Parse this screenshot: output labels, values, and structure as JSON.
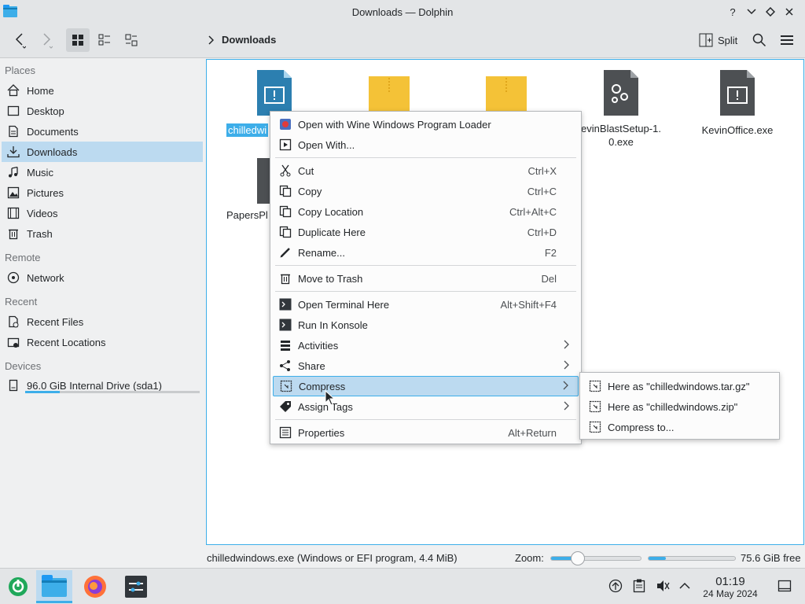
{
  "window": {
    "title": "Downloads — Dolphin"
  },
  "window_controls": {
    "help": "?",
    "minimize": "⌄",
    "maximize": "◇",
    "close": "✕"
  },
  "toolbar": {
    "breadcrumb_label": "Downloads",
    "split_label": "Split"
  },
  "sidebar": {
    "places_title": "Places",
    "places": [
      {
        "label": "Home",
        "icon": "home-icon"
      },
      {
        "label": "Desktop",
        "icon": "desktop-icon"
      },
      {
        "label": "Documents",
        "icon": "documents-icon"
      },
      {
        "label": "Downloads",
        "icon": "downloads-icon"
      },
      {
        "label": "Music",
        "icon": "music-icon"
      },
      {
        "label": "Pictures",
        "icon": "pictures-icon"
      },
      {
        "label": "Videos",
        "icon": "videos-icon"
      },
      {
        "label": "Trash",
        "icon": "trash-icon"
      }
    ],
    "remote_title": "Remote",
    "remote": [
      {
        "label": "Network",
        "icon": "network-icon"
      }
    ],
    "recent_title": "Recent",
    "recent": [
      {
        "label": "Recent Files",
        "icon": "recent-files-icon"
      },
      {
        "label": "Recent Locations",
        "icon": "recent-locations-icon"
      }
    ],
    "devices_title": "Devices",
    "devices": [
      {
        "label": "96.0 GiB Internal Drive (sda1)",
        "icon": "drive-icon",
        "usage_fraction": 0.2
      }
    ]
  },
  "files": [
    {
      "name": "chilledwi",
      "type": "exe",
      "selected": true
    },
    {
      "name": "",
      "type": "zip"
    },
    {
      "name": "",
      "type": "zip"
    },
    {
      "name": "KevinBlastSetup-1.0.exe",
      "line1": "evinBlastSetup-1.",
      "line2": "0.exe",
      "type": "setup"
    },
    {
      "name": "KevinOffice.exe",
      "type": "exe-dark"
    },
    {
      "name": "PapersPl",
      "type": "exe-dark"
    }
  ],
  "context_menu": {
    "items": [
      {
        "label": "Open with Wine Windows Program Loader",
        "icon": "wine-icon",
        "shortcut": ""
      },
      {
        "label": "Open With...",
        "icon": "open-with-icon",
        "shortcut": ""
      },
      {
        "label": "Cut",
        "icon": "cut-icon",
        "shortcut": "Ctrl+X"
      },
      {
        "label": "Copy",
        "icon": "copy-icon",
        "shortcut": "Ctrl+C"
      },
      {
        "label": "Copy Location",
        "icon": "copy-location-icon",
        "shortcut": "Ctrl+Alt+C"
      },
      {
        "label": "Duplicate Here",
        "icon": "duplicate-icon",
        "shortcut": "Ctrl+D"
      },
      {
        "label": "Rename...",
        "icon": "rename-icon",
        "shortcut": "F2"
      },
      {
        "label": "Move to Trash",
        "icon": "trash-icon",
        "shortcut": "Del"
      },
      {
        "label": "Open Terminal Here",
        "icon": "terminal-icon",
        "shortcut": "Alt+Shift+F4"
      },
      {
        "label": "Run In Konsole",
        "icon": "konsole-icon",
        "shortcut": ""
      },
      {
        "label": "Activities",
        "icon": "activities-icon",
        "shortcut": "",
        "submenu": true
      },
      {
        "label": "Share",
        "icon": "share-icon",
        "shortcut": "",
        "submenu": true
      },
      {
        "label": "Compress",
        "icon": "compress-icon",
        "shortcut": "",
        "submenu": true,
        "highlighted": true
      },
      {
        "label": "Assign Tags",
        "icon": "tag-icon",
        "shortcut": "",
        "submenu": true
      },
      {
        "label": "Properties",
        "icon": "properties-icon",
        "shortcut": "Alt+Return"
      }
    ]
  },
  "compress_submenu": {
    "items": [
      {
        "label": "Here as \"chilledwindows.tar.gz\"",
        "icon": "archive-icon"
      },
      {
        "label": "Here as \"chilledwindows.zip\"",
        "icon": "archive-icon"
      },
      {
        "label": "Compress to...",
        "icon": "archive-icon"
      }
    ]
  },
  "statusbar": {
    "file_info": "chilledwindows.exe (Windows or EFI program, 4.4 MiB)",
    "zoom_label": "Zoom:",
    "zoom_fraction": 0.3,
    "space_used_fraction": 0.2,
    "free_space": "75.6 GiB free"
  },
  "taskbar": {
    "time": "01:19",
    "date": "24 May 2024"
  },
  "colors": {
    "accent": "#3daee9",
    "selection": "#bcdaf0",
    "background": "#eff0f1"
  }
}
